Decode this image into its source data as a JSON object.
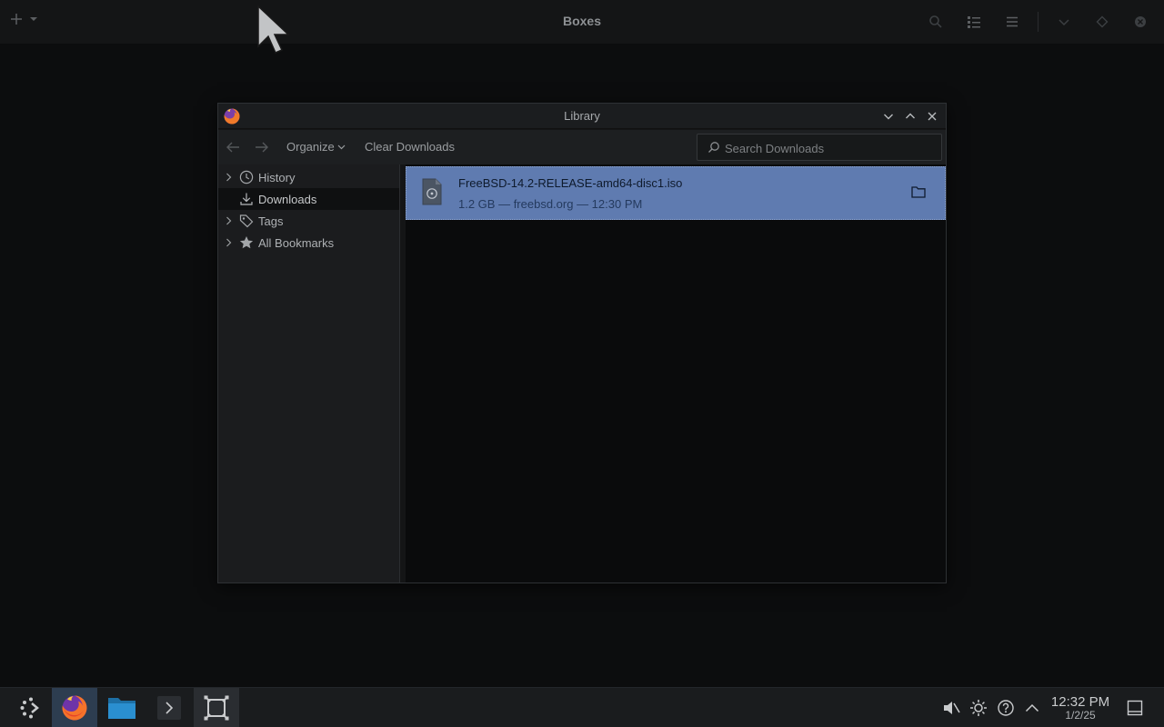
{
  "boxes": {
    "title": "Boxes"
  },
  "window": {
    "title": "Library",
    "toolbar": {
      "organize_label": "Organize",
      "clear_label": "Clear Downloads",
      "search_placeholder": "Search Downloads"
    },
    "sidebar": {
      "items": [
        {
          "label": "History",
          "icon": "clock-icon",
          "expandable": true,
          "selected": false
        },
        {
          "label": "Downloads",
          "icon": "download-icon",
          "expandable": false,
          "selected": true
        },
        {
          "label": "Tags",
          "icon": "tags-icon",
          "expandable": true,
          "selected": false
        },
        {
          "label": "All Bookmarks",
          "icon": "star-icon",
          "expandable": true,
          "selected": false
        }
      ]
    },
    "downloads": [
      {
        "filename": "FreeBSD-14.2-RELEASE-amd64-disc1.iso",
        "meta": "1.2 GB — freebsd.org — 12:30 PM",
        "selected": true
      }
    ]
  },
  "taskbar": {
    "apps": [
      "app-launcher-icon",
      "firefox-icon",
      "files-icon",
      "terminal-icon",
      "boxes-icon"
    ],
    "tray": [
      "volume-muted-icon",
      "brightness-icon",
      "help-icon",
      "expand-tray-icon"
    ],
    "clock": {
      "time": "12:32 PM",
      "date": "1/2/25"
    }
  },
  "colors": {
    "accent_selection": "#5f7bb0",
    "taskbar_active": "#2d3d50"
  }
}
